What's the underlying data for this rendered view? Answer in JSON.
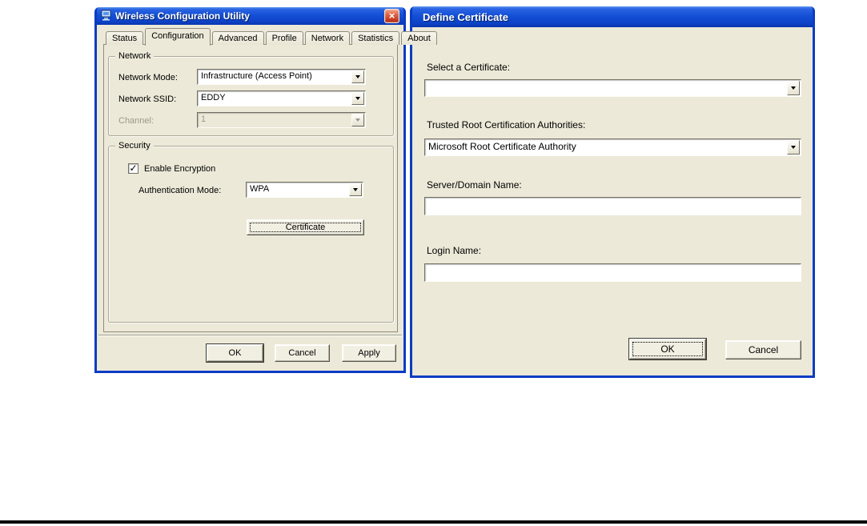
{
  "colors": {
    "titlebar_blue": "#0f4fd8",
    "window_border": "#0a3cc4",
    "dialog_bg": "#ece9d8",
    "close_red": "#cf4427",
    "bottom_rule": "#000000"
  },
  "left_window": {
    "title": "Wireless Configuration Utility",
    "close_button": "×",
    "tabs": [
      {
        "label": "Status"
      },
      {
        "label": "Configuration"
      },
      {
        "label": "Advanced"
      },
      {
        "label": "Profile"
      },
      {
        "label": "Network"
      },
      {
        "label": "Statistics"
      },
      {
        "label": "About"
      }
    ],
    "selected_tab": "Configuration",
    "network_group": {
      "title": "Network",
      "network_mode": {
        "label": "Network Mode:",
        "value": "Infrastructure (Access Point)"
      },
      "network_ssid": {
        "label": "Network SSID:",
        "value": "EDDY"
      },
      "channel": {
        "label": "Channel:",
        "value": "1",
        "disabled": true
      }
    },
    "security_group": {
      "title": "Security",
      "enable_encryption": {
        "label": "Enable Encryption",
        "checked": true,
        "checkmark": "✓"
      },
      "authentication_mode": {
        "label": "Authentication Mode:",
        "value": "WPA"
      },
      "certificate_button": "Certificate"
    },
    "footer": {
      "ok": "OK",
      "cancel": "Cancel",
      "apply": "Apply"
    }
  },
  "right_window": {
    "title": "Define Certificate",
    "select_certificate": {
      "label": "Select a Certificate:",
      "value": ""
    },
    "trusted_root": {
      "label": "Trusted Root Certification Authorities:",
      "value": "Microsoft Root Certificate Authority"
    },
    "server_domain": {
      "label": "Server/Domain Name:",
      "value": ""
    },
    "login_name": {
      "label": "Login Name:",
      "value": ""
    },
    "footer": {
      "ok": "OK",
      "cancel": "Cancel"
    }
  }
}
